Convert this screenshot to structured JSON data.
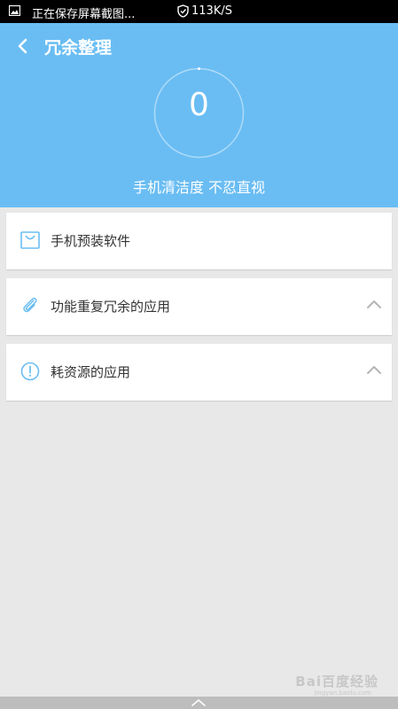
{
  "status_bar": {
    "notification_text": "正在保存屏幕截图...",
    "net_speed": "113K/S"
  },
  "header": {
    "title": "冗余整理",
    "score": "0",
    "caption": "手机清洁度 不忍直视",
    "bg_color": "#6abdf3"
  },
  "cards": [
    {
      "label": "手机预装软件",
      "icon": "shopping-bag-icon",
      "expanded_indicator": false
    },
    {
      "label": "功能重复冗余的应用",
      "icon": "paperclip-icon",
      "expanded_indicator": true
    },
    {
      "label": "耗资源的应用",
      "icon": "exclamation-circle-icon",
      "expanded_indicator": true
    }
  ],
  "watermark": {
    "brand": "Bai百度经验",
    "url": "jingyan.baidu.com"
  }
}
